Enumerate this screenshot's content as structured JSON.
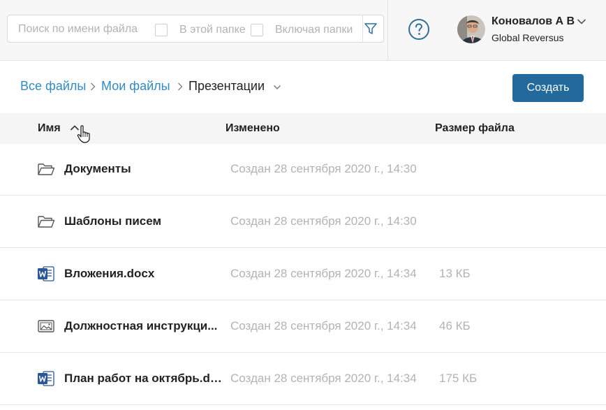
{
  "search": {
    "placeholder": "Поиск по имени файла",
    "in_folder_label": "В этой папке",
    "include_folders_label": "Включая папки"
  },
  "user": {
    "name": "Коновалов А В",
    "company": "Global Reversus"
  },
  "breadcrumb": {
    "items": [
      "Все файлы",
      "Мои файлы"
    ],
    "current": "Презентации"
  },
  "toolbar": {
    "create_label": "Создать"
  },
  "table": {
    "headers": {
      "name": "Имя",
      "modified": "Изменено",
      "size": "Размер файла"
    },
    "sort": "name ascending",
    "rows": [
      {
        "icon": "folder-icon",
        "name": "Документы",
        "modified": "Создан 28 сентября 2020 г., 14:30",
        "size": ""
      },
      {
        "icon": "folder-icon",
        "name": "Шаблоны писем",
        "modified": "Создан 28 сентября 2020 г., 14:30",
        "size": ""
      },
      {
        "icon": "word-icon",
        "name": "Вложения.docx",
        "modified": "Создан 28 сентября 2020 г., 14:34",
        "size": "13 КБ"
      },
      {
        "icon": "image-icon",
        "name": "Должностная инструкци...",
        "modified": "Создан 28 сентября 2020 г., 14:34",
        "size": "46 КБ"
      },
      {
        "icon": "word-icon",
        "name": "План работ на октябрь.do...",
        "modified": "Создан 28 сентября 2020 г., 14:34",
        "size": "175 КБ"
      }
    ]
  },
  "colors": {
    "link": "#2f8ac5",
    "primary_button": "#23699c",
    "word_blue": "#2b5797",
    "muted_text": "#b3b3b3"
  }
}
